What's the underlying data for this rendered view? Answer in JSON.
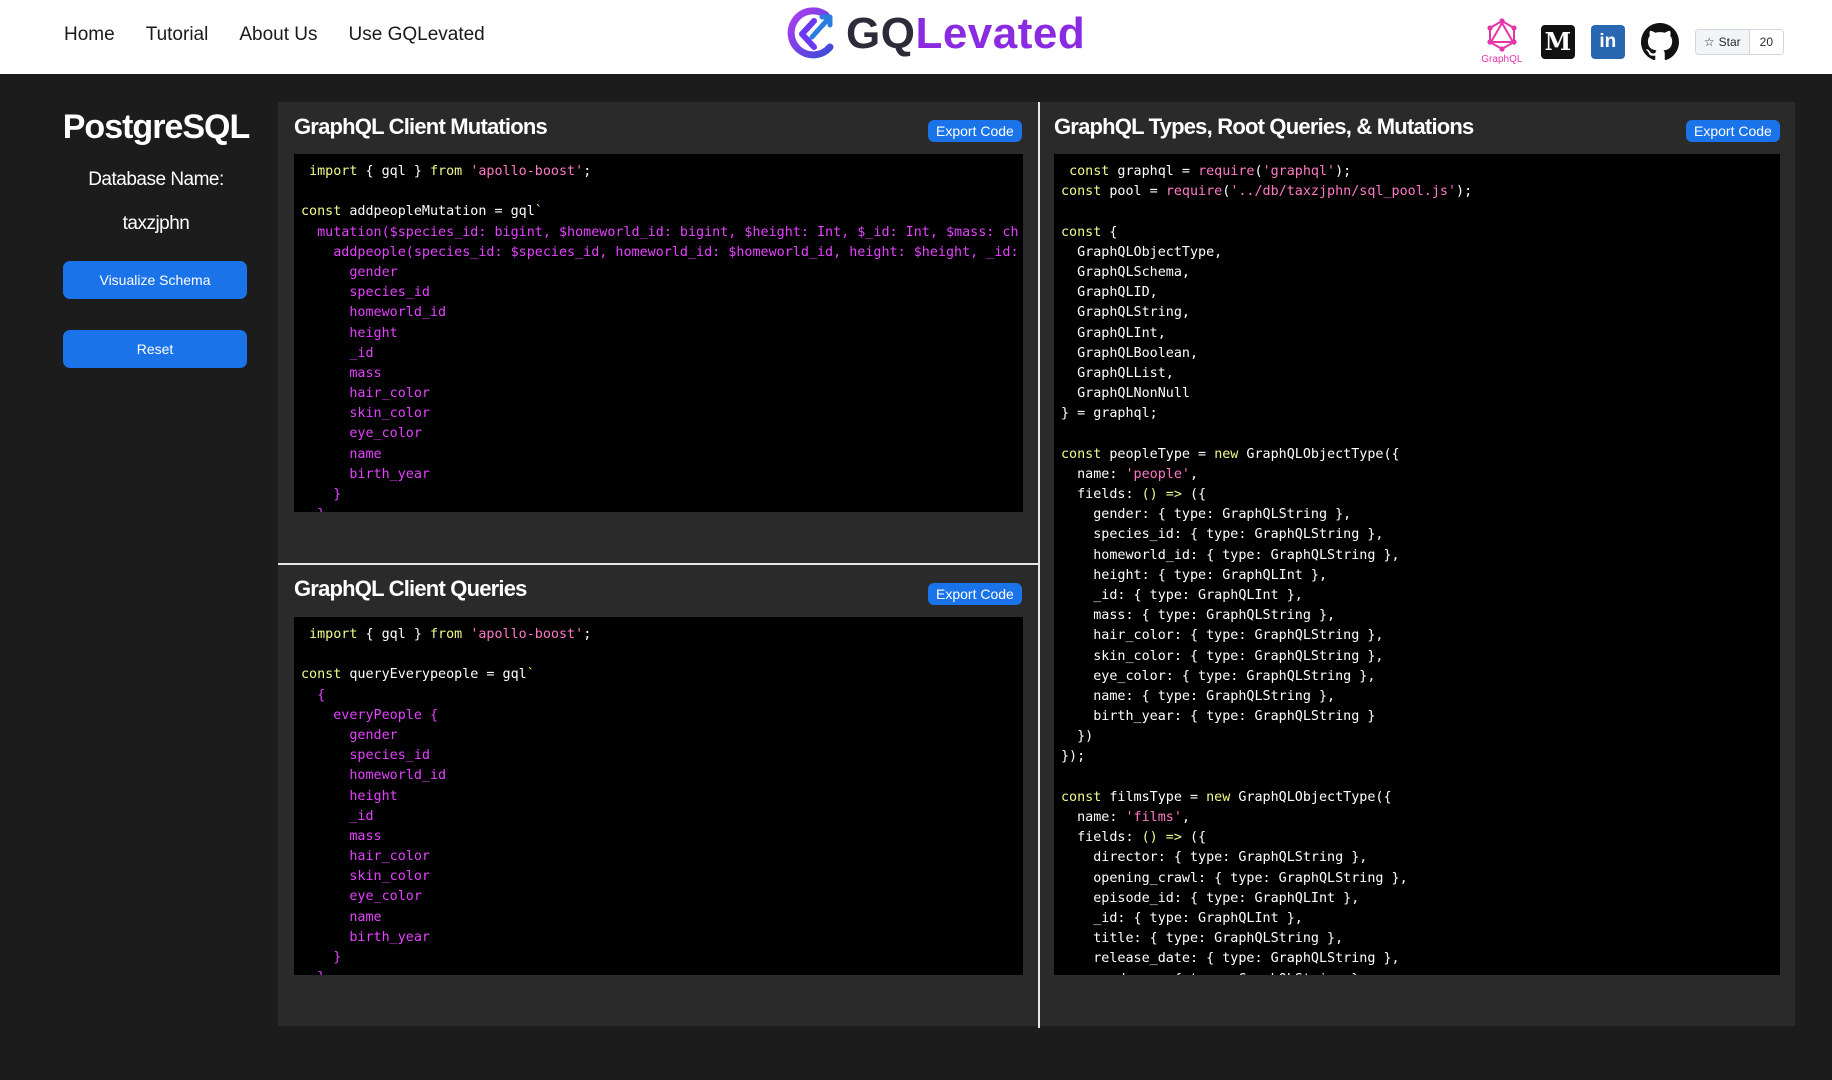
{
  "nav": {
    "links": [
      "Home",
      "Tutorial",
      "About Us",
      "Use GQLevated"
    ],
    "logo_text": "GQLevated",
    "graphql_label": "GraphQL",
    "medium_letter": "M",
    "linkedin_letters": "in",
    "star_label": "Star",
    "star_count": "20"
  },
  "sidebar": {
    "title": "PostgreSQL",
    "db_label": "Database Name:",
    "db_name": "taxzjphn",
    "visualize_button": "Visualize Schema",
    "reset_button": "Reset"
  },
  "panels": {
    "mutations": {
      "title": "GraphQL Client Mutations",
      "export_button": "Export Code",
      "code": [
        [
          [
            "w",
            " "
          ],
          [
            "k",
            "import"
          ],
          [
            "w",
            " { gql } "
          ],
          [
            "k",
            "from"
          ],
          [
            "w",
            " "
          ],
          [
            "s",
            "'apollo-boost'"
          ],
          [
            "w",
            ";"
          ]
        ],
        [],
        [
          [
            "k",
            "const"
          ],
          [
            "w",
            " addpeopleMutation = gql"
          ],
          [
            "k",
            "`"
          ]
        ],
        [
          [
            "p",
            "  mutation($species_id: bigint, $homeworld_id: bigint, $height: Int, $_id: Int, $mass: ch"
          ]
        ],
        [
          [
            "p",
            "    addpeople(species_id: $species_id, homeworld_id: $homeworld_id, height: $height, _id:"
          ]
        ],
        [
          [
            "p",
            "      gender"
          ]
        ],
        [
          [
            "p",
            "      species_id"
          ]
        ],
        [
          [
            "p",
            "      homeworld_id"
          ]
        ],
        [
          [
            "p",
            "      height"
          ]
        ],
        [
          [
            "p",
            "      _id"
          ]
        ],
        [
          [
            "p",
            "      mass"
          ]
        ],
        [
          [
            "p",
            "      hair_color"
          ]
        ],
        [
          [
            "p",
            "      skin_color"
          ]
        ],
        [
          [
            "p",
            "      eye_color"
          ]
        ],
        [
          [
            "p",
            "      name"
          ]
        ],
        [
          [
            "p",
            "      birth_year"
          ]
        ],
        [
          [
            "p",
            "    }"
          ]
        ],
        [
          [
            "p",
            "  }"
          ]
        ]
      ]
    },
    "queries": {
      "title": "GraphQL Client Queries",
      "export_button": "Export Code",
      "code": [
        [
          [
            "w",
            " "
          ],
          [
            "k",
            "import"
          ],
          [
            "w",
            " { gql } "
          ],
          [
            "k",
            "from"
          ],
          [
            "w",
            " "
          ],
          [
            "s",
            "'apollo-boost'"
          ],
          [
            "w",
            ";"
          ]
        ],
        [],
        [
          [
            "k",
            "const"
          ],
          [
            "w",
            " queryEverypeople = gql"
          ],
          [
            "k",
            "`"
          ]
        ],
        [
          [
            "p",
            "  {"
          ]
        ],
        [
          [
            "p",
            "    everyPeople {"
          ]
        ],
        [
          [
            "p",
            "      gender"
          ]
        ],
        [
          [
            "p",
            "      species_id"
          ]
        ],
        [
          [
            "p",
            "      homeworld_id"
          ]
        ],
        [
          [
            "p",
            "      height"
          ]
        ],
        [
          [
            "p",
            "      _id"
          ]
        ],
        [
          [
            "p",
            "      mass"
          ]
        ],
        [
          [
            "p",
            "      hair_color"
          ]
        ],
        [
          [
            "p",
            "      skin_color"
          ]
        ],
        [
          [
            "p",
            "      eye_color"
          ]
        ],
        [
          [
            "p",
            "      name"
          ]
        ],
        [
          [
            "p",
            "      birth_year"
          ]
        ],
        [
          [
            "p",
            "    }"
          ]
        ],
        [
          [
            "p",
            "  }"
          ]
        ]
      ]
    },
    "types": {
      "title": "GraphQL Types, Root Queries, & Mutations",
      "export_button": "Export Code",
      "code": [
        [
          [
            "w",
            " "
          ],
          [
            "k",
            "const"
          ],
          [
            "w",
            " graphql = "
          ],
          [
            "s",
            "require"
          ],
          [
            "w",
            "("
          ],
          [
            "s",
            "'graphql'"
          ],
          [
            "w",
            ");"
          ]
        ],
        [
          [
            "k",
            "const"
          ],
          [
            "w",
            " pool = "
          ],
          [
            "s",
            "require"
          ],
          [
            "w",
            "("
          ],
          [
            "s",
            "'../db/taxzjphn/sql_pool.js'"
          ],
          [
            "w",
            ");"
          ]
        ],
        [],
        [
          [
            "k",
            "const"
          ],
          [
            "w",
            " {"
          ]
        ],
        [
          [
            "w",
            "  GraphQLObjectType,"
          ]
        ],
        [
          [
            "w",
            "  GraphQLSchema,"
          ]
        ],
        [
          [
            "w",
            "  GraphQLID,"
          ]
        ],
        [
          [
            "w",
            "  GraphQLString,"
          ]
        ],
        [
          [
            "w",
            "  GraphQLInt,"
          ]
        ],
        [
          [
            "w",
            "  GraphQLBoolean,"
          ]
        ],
        [
          [
            "w",
            "  GraphQLList,"
          ]
        ],
        [
          [
            "w",
            "  GraphQLNonNull"
          ]
        ],
        [
          [
            "w",
            "} = graphql;"
          ]
        ],
        [],
        [
          [
            "k",
            "const"
          ],
          [
            "w",
            " peopleType = "
          ],
          [
            "k",
            "new"
          ],
          [
            "w",
            " GraphQLObjectType({"
          ]
        ],
        [
          [
            "w",
            "  name: "
          ],
          [
            "s",
            "'people'"
          ],
          [
            "w",
            ","
          ]
        ],
        [
          [
            "w",
            "  fields: "
          ],
          [
            "k",
            "() =>"
          ],
          [
            "w",
            " ({"
          ]
        ],
        [
          [
            "w",
            "    gender: { type: GraphQLString },"
          ]
        ],
        [
          [
            "w",
            "    species_id: { type: GraphQLString },"
          ]
        ],
        [
          [
            "w",
            "    homeworld_id: { type: GraphQLString },"
          ]
        ],
        [
          [
            "w",
            "    height: { type: GraphQLInt },"
          ]
        ],
        [
          [
            "w",
            "    _id: { type: GraphQLInt },"
          ]
        ],
        [
          [
            "w",
            "    mass: { type: GraphQLString },"
          ]
        ],
        [
          [
            "w",
            "    hair_color: { type: GraphQLString },"
          ]
        ],
        [
          [
            "w",
            "    skin_color: { type: GraphQLString },"
          ]
        ],
        [
          [
            "w",
            "    eye_color: { type: GraphQLString },"
          ]
        ],
        [
          [
            "w",
            "    name: { type: GraphQLString },"
          ]
        ],
        [
          [
            "w",
            "    birth_year: { type: GraphQLString }"
          ]
        ],
        [
          [
            "w",
            "  })"
          ]
        ],
        [
          [
            "w",
            "});"
          ]
        ],
        [],
        [
          [
            "k",
            "const"
          ],
          [
            "w",
            " filmsType = "
          ],
          [
            "k",
            "new"
          ],
          [
            "w",
            " GraphQLObjectType({"
          ]
        ],
        [
          [
            "w",
            "  name: "
          ],
          [
            "s",
            "'films'"
          ],
          [
            "w",
            ","
          ]
        ],
        [
          [
            "w",
            "  fields: "
          ],
          [
            "k",
            "() =>"
          ],
          [
            "w",
            " ({"
          ]
        ],
        [
          [
            "w",
            "    director: { type: GraphQLString },"
          ]
        ],
        [
          [
            "w",
            "    opening_crawl: { type: GraphQLString },"
          ]
        ],
        [
          [
            "w",
            "    episode_id: { type: GraphQLInt },"
          ]
        ],
        [
          [
            "w",
            "    _id: { type: GraphQLInt },"
          ]
        ],
        [
          [
            "w",
            "    title: { type: GraphQLString },"
          ]
        ],
        [
          [
            "w",
            "    release_date: { type: GraphQLString },"
          ]
        ],
        [
          [
            "w",
            "    producer: { type: GraphQLString },"
          ]
        ]
      ]
    }
  },
  "colors": {
    "accent": "#1a73e8",
    "logo_purple": "#7b2ff7",
    "graphql_pink": "#e535ab",
    "code_keyword": "#f1fa8c",
    "code_string": "#ff79c6",
    "code_graphql": "#e542ff"
  }
}
